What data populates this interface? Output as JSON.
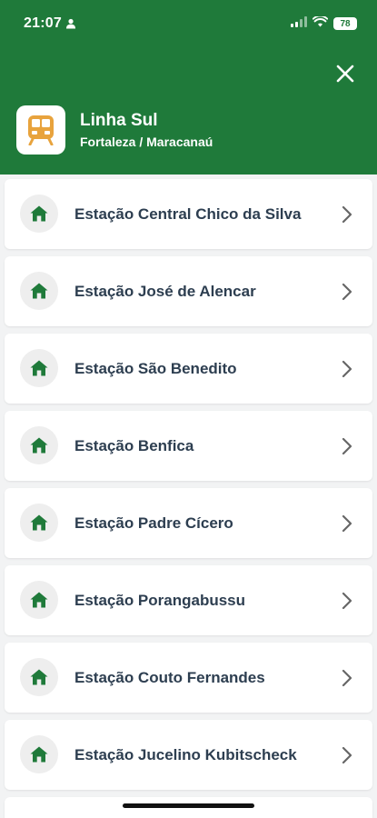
{
  "status_bar": {
    "time": "21:07",
    "battery": "78",
    "icons": [
      "person-icon",
      "signal-icon",
      "wifi-icon",
      "battery-icon"
    ]
  },
  "header": {
    "line_name": "Linha Sul",
    "subtitle": "Fortaleza / Maracanaú",
    "close_icon": "close-icon",
    "logo_icon": "tram-icon"
  },
  "stations": [
    {
      "name": "Estação Central Chico da Silva"
    },
    {
      "name": "Estação José de Alencar"
    },
    {
      "name": "Estação São Benedito"
    },
    {
      "name": "Estação Benfica"
    },
    {
      "name": "Estação Padre Cícero"
    },
    {
      "name": "Estação Porangabussu"
    },
    {
      "name": "Estação Couto Fernandes"
    },
    {
      "name": "Estação Jucelino Kubitscheck"
    }
  ],
  "colors": {
    "brand_green": "#1f7a3a",
    "logo_orange": "#e8a33d",
    "station_text": "#2d3e50"
  }
}
